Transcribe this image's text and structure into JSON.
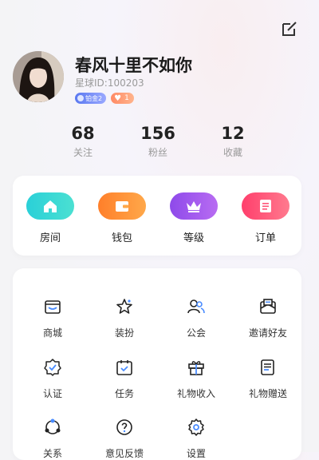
{
  "profile": {
    "name": "春风十里不如你",
    "id_text": "星球ID:100203",
    "badge_level": "铂金2",
    "badge_heart_count": "1"
  },
  "stats": [
    {
      "num": "68",
      "label": "关注"
    },
    {
      "num": "156",
      "label": "粉丝"
    },
    {
      "num": "12",
      "label": "收藏"
    }
  ],
  "quick_actions": [
    {
      "label": "房间",
      "icon": "home-icon",
      "color": "#2fd1d6"
    },
    {
      "label": "钱包",
      "icon": "wallet-icon",
      "color": "#ff8a2b"
    },
    {
      "label": "等级",
      "icon": "crown-icon",
      "color": "#9d52ec"
    },
    {
      "label": "订单",
      "icon": "order-icon",
      "color": "#ff4d72"
    }
  ],
  "menu": [
    {
      "label": "商城",
      "icon": "store-icon"
    },
    {
      "label": "装扮",
      "icon": "dress-up-icon"
    },
    {
      "label": "公会",
      "icon": "guild-icon"
    },
    {
      "label": "邀请好友",
      "icon": "invite-icon"
    },
    {
      "label": "认证",
      "icon": "verify-icon"
    },
    {
      "label": "任务",
      "icon": "task-icon"
    },
    {
      "label": "礼物收入",
      "icon": "gift-icon"
    },
    {
      "label": "礼物赠送",
      "icon": "gift-send-icon"
    },
    {
      "label": "关系",
      "icon": "relation-icon"
    },
    {
      "label": "意见反馈",
      "icon": "feedback-icon"
    },
    {
      "label": "设置",
      "icon": "settings-icon"
    }
  ]
}
